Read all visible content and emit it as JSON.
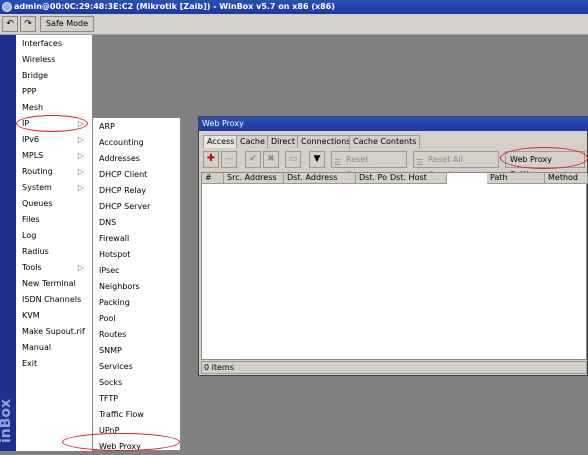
{
  "window": {
    "title": "admin@00:0C:29:48:3E:C2 (Mikrotik [Zaib]) - WinBox v5.7 on x86 (x86)",
    "vertical_label": "inBox"
  },
  "toolbar": {
    "undo_icon": "↶",
    "redo_icon": "↷",
    "safe_mode_label": "Safe Mode"
  },
  "sidebar": {
    "items": [
      {
        "label": "Interfaces"
      },
      {
        "label": "Wireless"
      },
      {
        "label": "Bridge"
      },
      {
        "label": "PPP"
      },
      {
        "label": "Mesh"
      },
      {
        "label": "IP",
        "arrow": "▷"
      },
      {
        "label": "IPv6",
        "arrow": "▷"
      },
      {
        "label": "MPLS",
        "arrow": "▷"
      },
      {
        "label": "Routing",
        "arrow": "▷"
      },
      {
        "label": "System",
        "arrow": "▷"
      },
      {
        "label": "Queues"
      },
      {
        "label": "Files"
      },
      {
        "label": "Log"
      },
      {
        "label": "Radius"
      },
      {
        "label": "Tools",
        "arrow": "▷"
      },
      {
        "label": "New Terminal"
      },
      {
        "label": "ISDN Channels"
      },
      {
        "label": "KVM"
      },
      {
        "label": "Make Supout.rif"
      },
      {
        "label": "Manual"
      },
      {
        "label": "Exit"
      }
    ]
  },
  "ip_submenu": {
    "items": [
      "ARP",
      "Accounting",
      "Addresses",
      "DHCP Client",
      "DHCP Relay",
      "DHCP Server",
      "DNS",
      "Firewall",
      "Hotspot",
      "IPsec",
      "Neighbors",
      "Packing",
      "Pool",
      "Routes",
      "SNMP",
      "Services",
      "Socks",
      "TFTP",
      "Traffic Flow",
      "UPnP",
      "Web Proxy"
    ]
  },
  "web_proxy": {
    "title": "Web Proxy",
    "tabs": [
      "Access",
      "Cache",
      "Direct",
      "Connections",
      "Cache Contents"
    ],
    "buttons": {
      "add_icon": "✚",
      "remove_icon": "—",
      "enable_icon": "✔",
      "disable_icon": "✖",
      "comment_icon": "▭",
      "filter_icon": "▼",
      "reset_counters": "Reset Counters",
      "reset_all_counters": "Reset All Counters",
      "settings": "Web Proxy Settings"
    },
    "columns": [
      "#",
      "Src. Address",
      "Dst. Address",
      "Dst. Port",
      "Dst. Host",
      "Path",
      "Method"
    ],
    "status": "0 items"
  },
  "colors": {
    "title_bar": "#1c3a9c",
    "sidebar_strip": "#1e2f8f",
    "highlight_ring": "#dd2222"
  }
}
